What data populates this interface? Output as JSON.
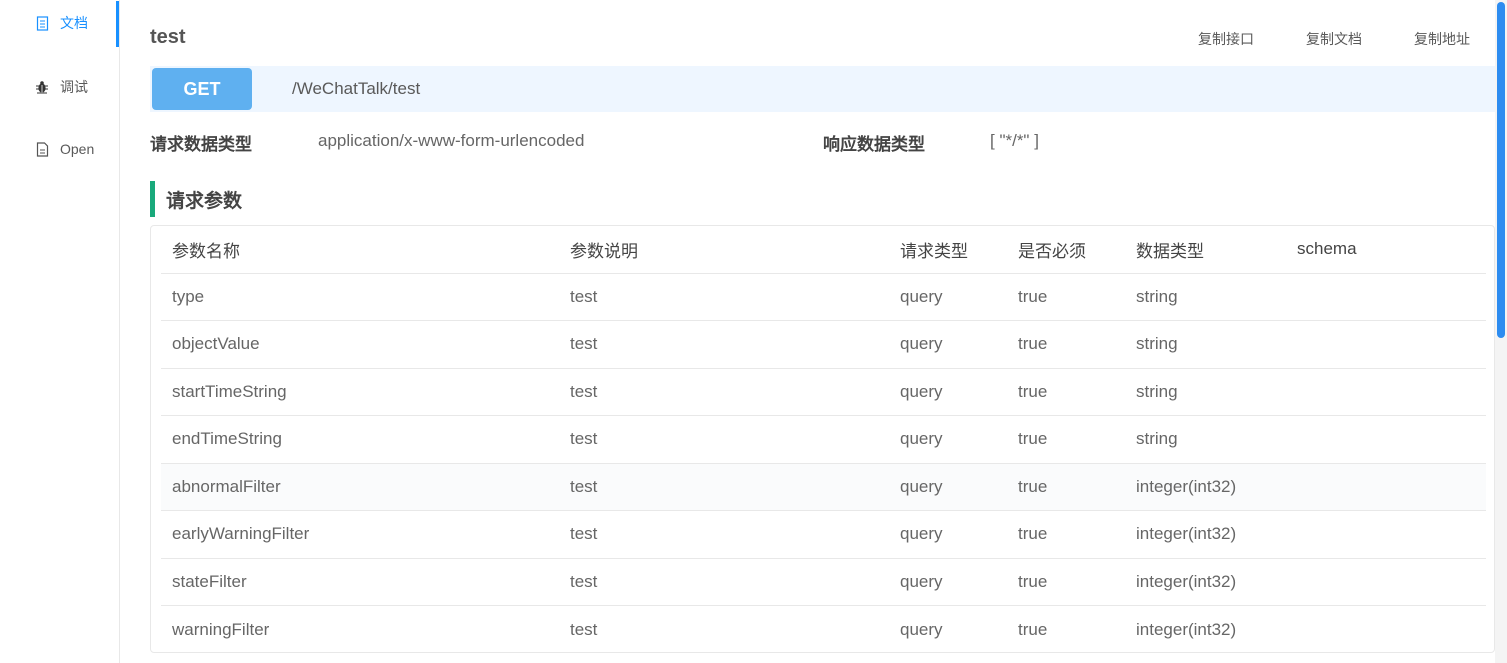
{
  "sidebar": {
    "items": [
      {
        "label": "文档",
        "icon": "document-icon",
        "active": true
      },
      {
        "label": "调试",
        "icon": "bug-icon",
        "active": false
      },
      {
        "label": "Open",
        "icon": "file-icon",
        "active": false
      }
    ]
  },
  "header": {
    "title": "test",
    "actions": {
      "copy_api": "复制接口",
      "copy_doc": "复制文档",
      "copy_url": "复制地址"
    }
  },
  "endpoint": {
    "method": "GET",
    "path": "/WeChatTalk/test"
  },
  "meta": {
    "request_type_label": "请求数据类型",
    "request_type_value": "application/x-www-form-urlencoded",
    "response_type_label": "响应数据类型",
    "response_type_value": "[ \"*/*\" ]"
  },
  "params": {
    "section_title": "请求参数",
    "columns": [
      "参数名称",
      "参数说明",
      "请求类型",
      "是否必须",
      "数据类型",
      "schema"
    ],
    "rows": [
      {
        "name": "type",
        "desc": "test",
        "in": "query",
        "required": "true",
        "type": "string",
        "schema": ""
      },
      {
        "name": "objectValue",
        "desc": "test",
        "in": "query",
        "required": "true",
        "type": "string",
        "schema": ""
      },
      {
        "name": "startTimeString",
        "desc": "test",
        "in": "query",
        "required": "true",
        "type": "string",
        "schema": ""
      },
      {
        "name": "endTimeString",
        "desc": "test",
        "in": "query",
        "required": "true",
        "type": "string",
        "schema": ""
      },
      {
        "name": "abnormalFilter",
        "desc": "test",
        "in": "query",
        "required": "true",
        "type": "integer(int32)",
        "schema": ""
      },
      {
        "name": "earlyWarningFilter",
        "desc": "test",
        "in": "query",
        "required": "true",
        "type": "integer(int32)",
        "schema": ""
      },
      {
        "name": "stateFilter",
        "desc": "test",
        "in": "query",
        "required": "true",
        "type": "integer(int32)",
        "schema": ""
      },
      {
        "name": "warningFilter",
        "desc": "test",
        "in": "query",
        "required": "true",
        "type": "integer(int32)",
        "schema": ""
      }
    ]
  },
  "colors": {
    "accent": "#1890ff",
    "method_badge": "#5fb0f0",
    "section_bar": "#19a97b",
    "query_text": "#4aa3f5",
    "required_text": "#e00000"
  }
}
